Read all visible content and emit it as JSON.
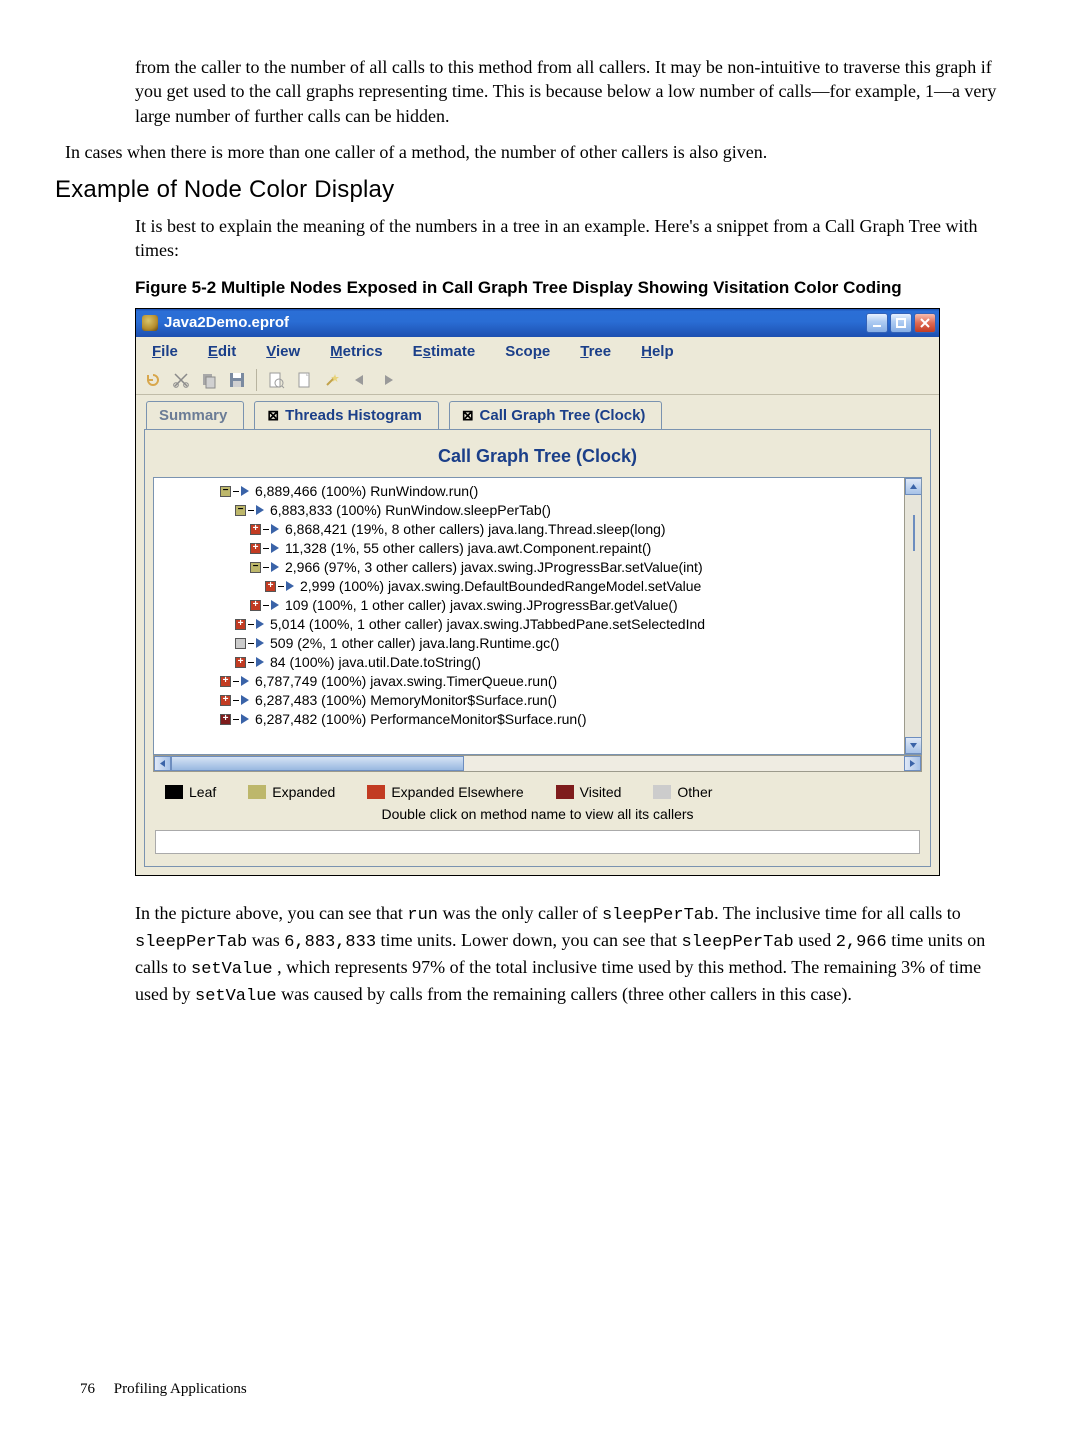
{
  "doc": {
    "para1": "from the caller to the number of all calls to this method from all callers. It may be non-intuitive to traverse this graph if you get used to the call graphs representing time. This is because below a low number of calls—for example, 1—a very large number of further calls can be hidden.",
    "para2": "In cases when there is more than one caller of a method, the number of other callers is also given.",
    "headingExample": "Example of Node Color Display",
    "para3": "It is best to explain the meaning of the numbers in a tree in an example. Here's a snippet from a Call Graph Tree with times:",
    "figCaption": "Figure 5-2 Multiple Nodes Exposed in Call Graph Tree Display Showing Visitation Color Coding",
    "para4_1": "In the picture above, you can see that ",
    "para4_code1": "run",
    "para4_2": " was the only caller of ",
    "para4_code2": "sleepPerTab",
    "para4_3": ". The inclusive time for all calls to ",
    "para4_code3": "sleepPerTab",
    "para4_4": " was ",
    "para4_code4": "6,883,833",
    "para4_5": " time units. Lower down, you can see that ",
    "para4_code5": "sleepPerTab",
    "para4_6": " used ",
    "para4_code6": "2,966",
    "para4_7": " time units on calls to ",
    "para4_code7": "setValue",
    "para4_8": " , which represents 97% of the total inclusive time used by this method. The remaining 3% of time used by ",
    "para4_code8": "setValue",
    "para4_9": " was caused by calls from the remaining callers (three other callers in this case).",
    "pageNum": "76",
    "footerTitle": "Profiling Applications"
  },
  "app": {
    "title": "Java2Demo.eprof",
    "menus": [
      {
        "label": "File",
        "u": "F"
      },
      {
        "label": "Edit",
        "u": "E"
      },
      {
        "label": "View",
        "u": "V"
      },
      {
        "label": "Metrics",
        "u": "M"
      },
      {
        "label": "Estimate",
        "u": "s"
      },
      {
        "label": "Scope",
        "u": "p"
      },
      {
        "label": "Tree",
        "u": "T"
      },
      {
        "label": "Help",
        "u": "H"
      }
    ],
    "tabs": {
      "summary": "Summary",
      "hist": "Threads Histogram",
      "tree": "Call Graph Tree (Clock)"
    },
    "panelTitle": "Call Graph Tree (Clock)",
    "treeRows": [
      {
        "indent": 4,
        "box": "expanded",
        "sign": "−",
        "text": "6,889,466 (100%) RunWindow.run()"
      },
      {
        "indent": 5,
        "box": "expanded",
        "sign": "−",
        "text": "6,883,833 (100%) RunWindow.sleepPerTab()"
      },
      {
        "indent": 6,
        "box": "ee",
        "sign": "+",
        "text": "6,868,421 (19%, 8 other callers) java.lang.Thread.sleep(long)"
      },
      {
        "indent": 6,
        "box": "ee",
        "sign": "+",
        "text": "11,328 (1%, 55 other callers) java.awt.Component.repaint()"
      },
      {
        "indent": 6,
        "box": "expanded",
        "sign": "−",
        "text": "2,966 (97%, 3 other callers) javax.swing.JProgressBar.setValue(int)"
      },
      {
        "indent": 7,
        "box": "ee",
        "sign": "+",
        "text": "2,999 (100%) javax.swing.DefaultBoundedRangeModel.setValue"
      },
      {
        "indent": 6,
        "box": "ee",
        "sign": "+",
        "text": "109 (100%, 1 other caller) javax.swing.JProgressBar.getValue()"
      },
      {
        "indent": 5,
        "box": "ee",
        "sign": "+",
        "text": "5,014 (100%, 1 other caller) javax.swing.JTabbedPane.setSelectedInd"
      },
      {
        "indent": 5,
        "box": "other",
        "sign": "",
        "text": "509 (2%, 1 other caller) java.lang.Runtime.gc()"
      },
      {
        "indent": 5,
        "box": "ee",
        "sign": "+",
        "text": "84 (100%) java.util.Date.toString()"
      },
      {
        "indent": 4,
        "box": "ee",
        "sign": "+",
        "text": "6,787,749 (100%) javax.swing.TimerQueue.run()"
      },
      {
        "indent": 4,
        "box": "ee",
        "sign": "+",
        "text": "6,287,483 (100%) MemoryMonitor$Surface.run()"
      },
      {
        "indent": 4,
        "box": "visited",
        "sign": "+",
        "text": "6,287,482 (100%) PerformanceMonitor$Surface.run()"
      }
    ],
    "legend": {
      "leaf": "Leaf",
      "expanded": "Expanded",
      "ee": "Expanded Elsewhere",
      "visited": "Visited",
      "other": "Other"
    },
    "hint": "Double click on method name to view all its callers"
  }
}
